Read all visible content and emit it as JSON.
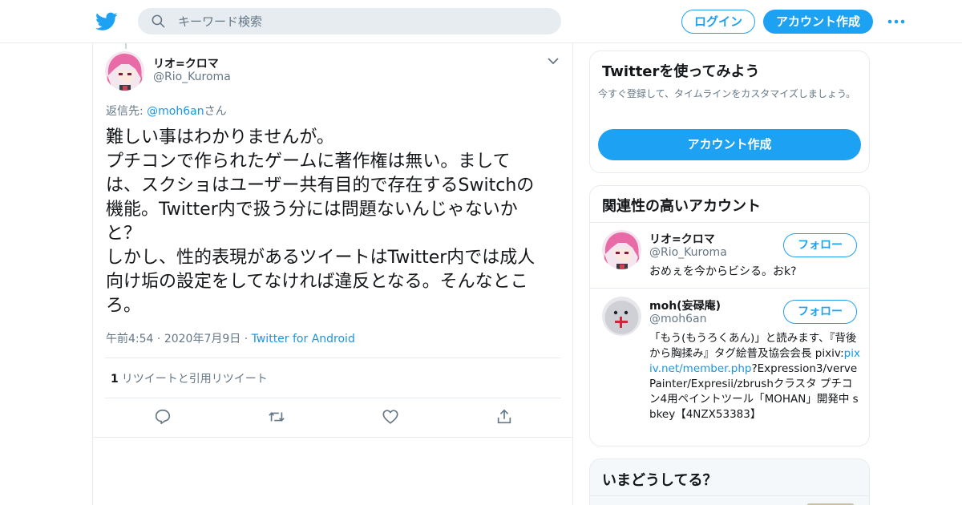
{
  "header": {
    "search_placeholder": "キーワード検索",
    "login_label": "ログイン",
    "signup_label": "アカウント作成"
  },
  "tweet": {
    "author_name": "リオ=クロマ",
    "author_handle": "@Rio_Kuroma",
    "reply_prefix": "返信先: ",
    "reply_to": "@moh6an",
    "reply_suffix": "さん",
    "text": "難しい事はわかりませんが。\nプチコンで作られたゲームに著作権は無い。まして\nは、スクショはユーザー共有目的で存在するSwitchの\n機能。Twitter内で扱う分には問題ないんじゃないか\nと？\nしかし、性的表現があるツイートはTwitter内では成人\n向け垢の設定をしてなければ違反となる。そんなとこ\nろ。",
    "time": "午前4:54",
    "date": "2020年7月9日",
    "source": "Twitter for Android",
    "retweet_count": "1",
    "retweet_label": "リツイートと引用リツイート"
  },
  "signup_card": {
    "title": "Twitterを使ってみよう",
    "description": "今すぐ登録して、タイムラインをカスタマイズしましょう。",
    "button_label": "アカウント作成"
  },
  "related_card": {
    "title": "関連性の高いアカウント",
    "accounts": [
      {
        "name": "リオ=クロマ",
        "handle": "@Rio_Kuroma",
        "follow_label": "フォロー",
        "bio": "おめぇを今からビシる。おk?"
      },
      {
        "name": "moh(妄碌庵)",
        "handle": "@moh6an",
        "follow_label": "フォロー",
        "bio_before": "「もう(もうろくあん)」と読みます、『背後から胸揉み』タグ絵普及協会会長 pixiv:",
        "bio_link": "pixiv.net/member.php",
        "bio_after": "?Expression3/vervePainter/Expresii/zbrushクラスタ プチコン4用ペイントツール「MOHAN」開発中 sbkey【4NZX53383】"
      }
    ]
  },
  "trends_card": {
    "title": "いまどうしてる？"
  },
  "colors": {
    "brand": "#1da1f2",
    "link": "#1b95e0",
    "muted": "#657786",
    "border": "#e6ecf0"
  },
  "icons": [
    "twitter-bird-icon",
    "search-icon",
    "more-dots-icon",
    "chevron-down-icon",
    "reply-icon",
    "retweet-icon",
    "like-icon",
    "share-icon"
  ]
}
